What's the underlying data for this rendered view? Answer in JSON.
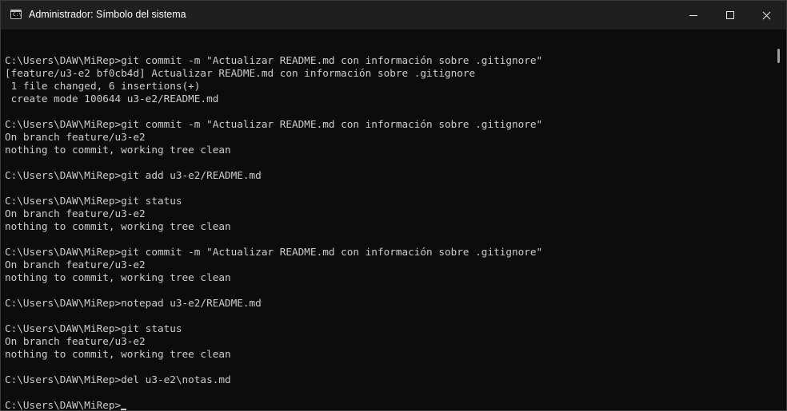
{
  "window": {
    "title": "Administrador: Símbolo del sistema",
    "icon": "cmd-icon",
    "icon_text": "C:\\",
    "controls": [
      "minimize-icon",
      "maximize-icon",
      "close-icon"
    ]
  },
  "console": {
    "lines": [
      "C:\\Users\\DAW\\MiRep>git commit -m \"Actualizar README.md con información sobre .gitignore\"",
      "[feature/u3-e2 bf0cb4d] Actualizar README.md con información sobre .gitignore",
      " 1 file changed, 6 insertions(+)",
      " create mode 100644 u3-e2/README.md",
      "",
      "C:\\Users\\DAW\\MiRep>git commit -m \"Actualizar README.md con información sobre .gitignore\"",
      "On branch feature/u3-e2",
      "nothing to commit, working tree clean",
      "",
      "C:\\Users\\DAW\\MiRep>git add u3-e2/README.md",
      "",
      "C:\\Users\\DAW\\MiRep>git status",
      "On branch feature/u3-e2",
      "nothing to commit, working tree clean",
      "",
      "C:\\Users\\DAW\\MiRep>git commit -m \"Actualizar README.md con información sobre .gitignore\"",
      "On branch feature/u3-e2",
      "nothing to commit, working tree clean",
      "",
      "C:\\Users\\DAW\\MiRep>notepad u3-e2/README.md",
      "",
      "C:\\Users\\DAW\\MiRep>git status",
      "On branch feature/u3-e2",
      "nothing to commit, working tree clean",
      "",
      "C:\\Users\\DAW\\MiRep>del u3-e2\\notas.md",
      ""
    ],
    "prompt": "C:\\Users\\DAW\\MiRep>"
  }
}
